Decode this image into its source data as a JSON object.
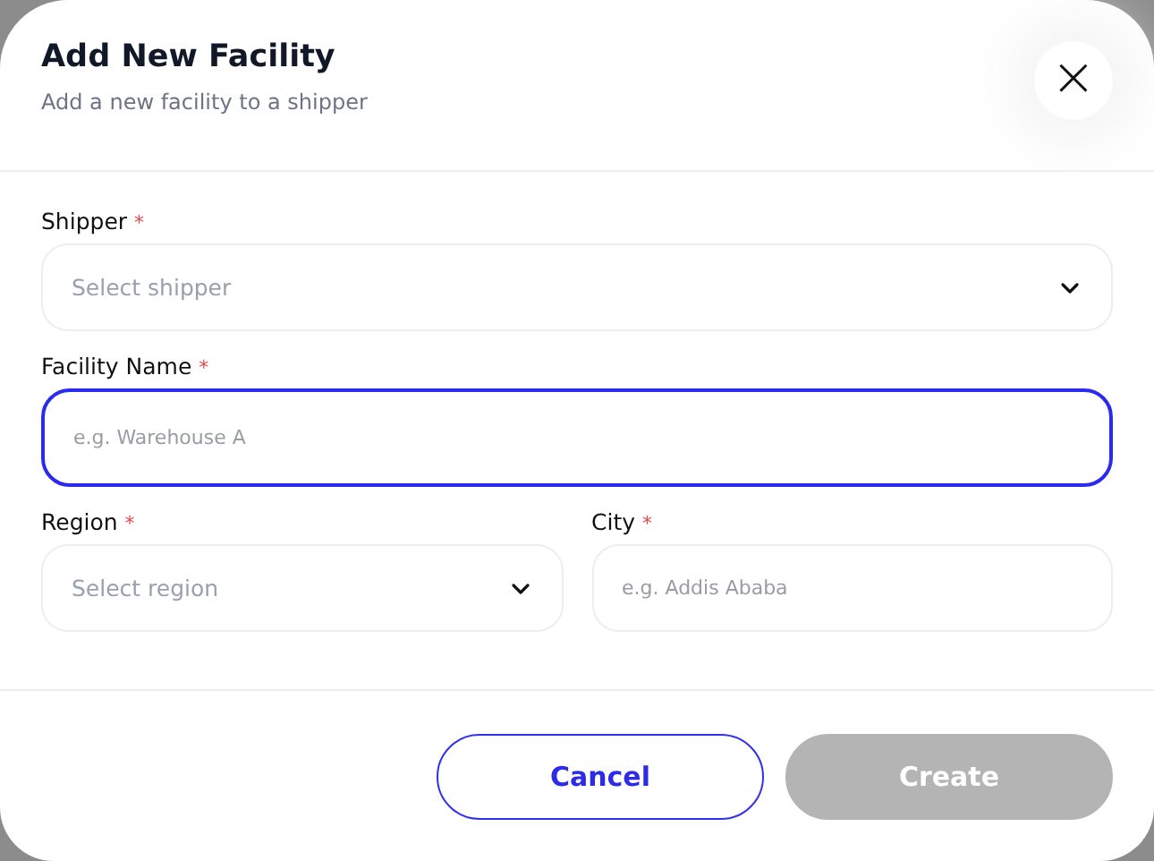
{
  "dialog": {
    "title": "Add New Facility",
    "subtitle": "Add a new facility to a shipper",
    "close_icon": "×"
  },
  "rows": [
    [
      {
        "kind": "select",
        "label": "Shipper",
        "required_mark": "*",
        "placeholder": "Select shipper",
        "focused": false
      }
    ],
    [
      {
        "kind": "input",
        "label": "Facility Name",
        "required_mark": "*",
        "placeholder": "e.g. Warehouse A",
        "focused": true
      }
    ],
    [
      {
        "kind": "select",
        "label": "Region",
        "required_mark": "*",
        "placeholder": "Select region",
        "focused": false
      },
      {
        "kind": "input",
        "label": "City",
        "required_mark": "*",
        "placeholder": "e.g. Addis Ababa",
        "focused": false
      }
    ]
  ],
  "buttons": [
    {
      "kind": "secondary",
      "label": "Cancel",
      "disabled": false
    },
    {
      "kind": "primary",
      "label": "Create",
      "disabled": true
    }
  ]
}
